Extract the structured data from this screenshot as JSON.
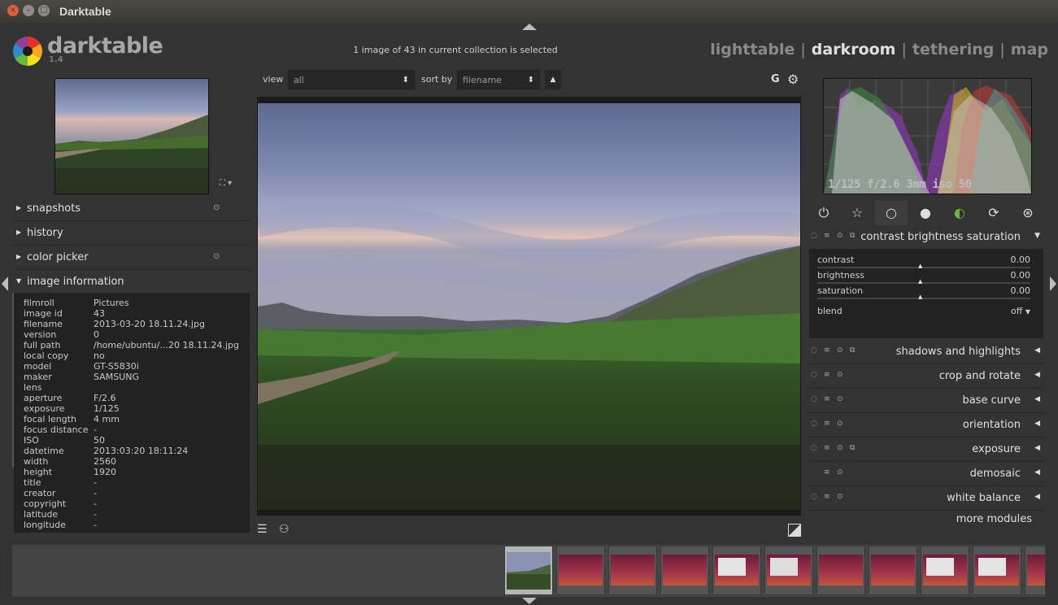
{
  "window": {
    "title": "Darktable"
  },
  "app": {
    "name": "darktable",
    "version": "1.4"
  },
  "header": {
    "collection_info": "1 image of 43 in current collection is selected",
    "views": [
      "lighttable",
      "darkroom",
      "tethering",
      "map"
    ],
    "active_view": "darkroom"
  },
  "left_panel": {
    "sections": [
      {
        "label": "snapshots",
        "expanded": false
      },
      {
        "label": "history",
        "expanded": false
      },
      {
        "label": "color picker",
        "expanded": false
      },
      {
        "label": "image information",
        "expanded": true
      }
    ],
    "image_info": [
      {
        "key": "filmroll",
        "value": "Pictures"
      },
      {
        "key": "image id",
        "value": "43"
      },
      {
        "key": "filename",
        "value": "2013-03-20 18.11.24.jpg"
      },
      {
        "key": "version",
        "value": "0"
      },
      {
        "key": "full path",
        "value": "/home/ubuntu/...20 18.11.24.jpg"
      },
      {
        "key": "local copy",
        "value": "no"
      },
      {
        "key": "model",
        "value": "GT-S5830i"
      },
      {
        "key": "maker",
        "value": "SAMSUNG"
      },
      {
        "key": "lens",
        "value": ""
      },
      {
        "key": "aperture",
        "value": "F/2.6"
      },
      {
        "key": "exposure",
        "value": "1/125"
      },
      {
        "key": "focal length",
        "value": "4 mm"
      },
      {
        "key": "focus distance",
        "value": "-"
      },
      {
        "key": "ISO",
        "value": "50"
      },
      {
        "key": "datetime",
        "value": "2013:03:20 18:11:24"
      },
      {
        "key": "width",
        "value": "2560"
      },
      {
        "key": "height",
        "value": "1920"
      },
      {
        "key": "title",
        "value": "-"
      },
      {
        "key": "creator",
        "value": "-"
      },
      {
        "key": "copyright",
        "value": "-"
      },
      {
        "key": "latitude",
        "value": "-"
      },
      {
        "key": "longitude",
        "value": "-"
      }
    ]
  },
  "center": {
    "view_label": "view",
    "view_value": "all",
    "sort_label": "sort by",
    "sort_value": "filename",
    "grouping_label": "G"
  },
  "right_panel": {
    "histogram_info": "1/125 f/2.6 3mm iso 50",
    "module_groups": [
      "power-icon",
      "star-icon",
      "circle-icon",
      "sphere-icon",
      "color-icon",
      "rotate-icon",
      "aperture-icon"
    ],
    "active_group_index": 2,
    "expanded_module": {
      "label": "contrast brightness saturation",
      "sliders": [
        {
          "name": "contrast",
          "value": "0.00"
        },
        {
          "name": "brightness",
          "value": "0.00"
        },
        {
          "name": "saturation",
          "value": "0.00"
        }
      ],
      "blend_label": "blend",
      "blend_value": "off"
    },
    "modules": [
      "shadows and highlights",
      "crop and rotate",
      "base curve",
      "orientation",
      "exposure",
      "demosaic",
      "white balance"
    ],
    "more_modules": "more modules"
  },
  "colors": {
    "background": "#333333",
    "panel_dark": "#222222",
    "text": "#c8c8c8",
    "active_view": "#e0e0e0"
  }
}
